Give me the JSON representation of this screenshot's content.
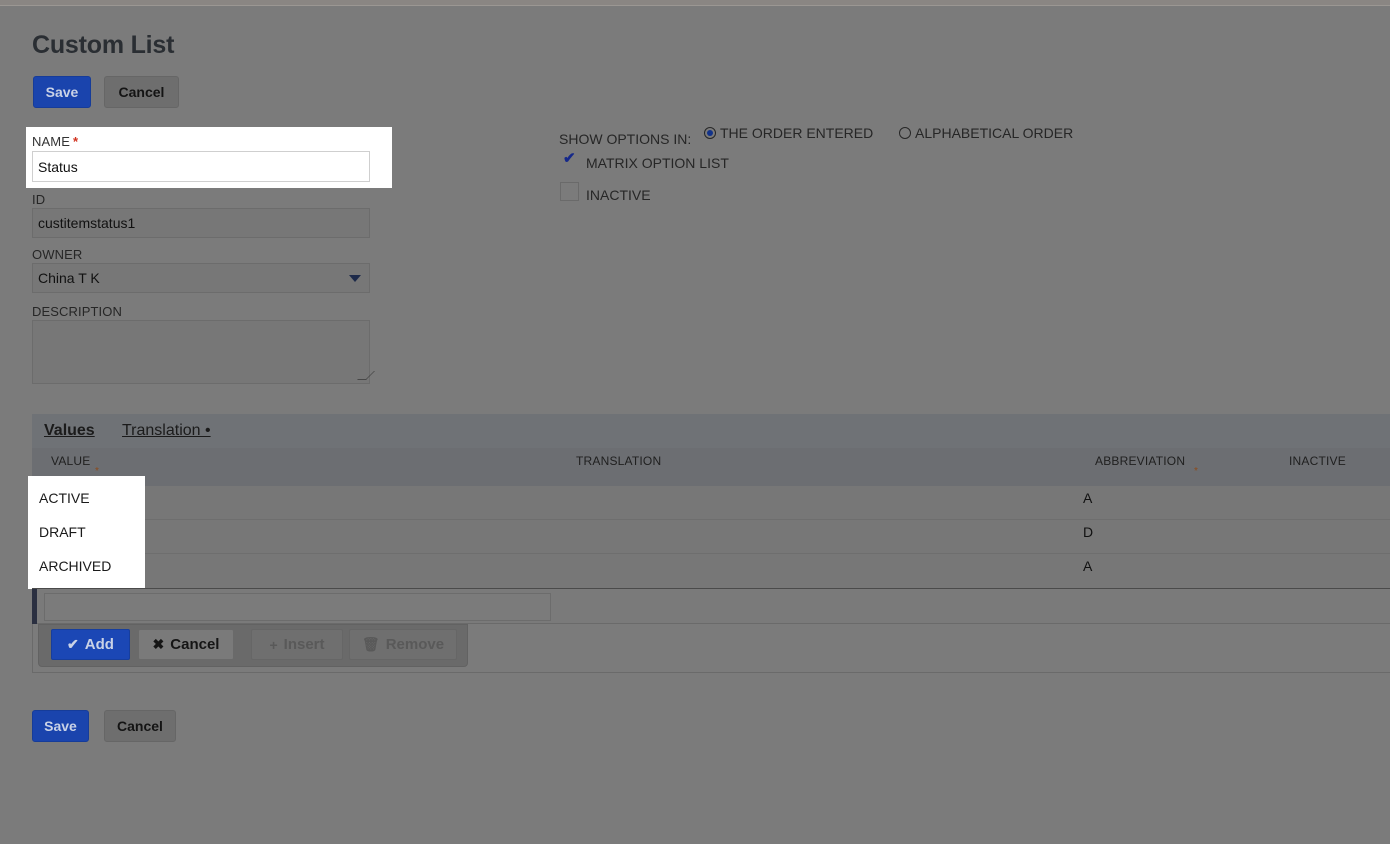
{
  "page": {
    "title": "Custom List"
  },
  "top_actions": {
    "save_label": "Save",
    "cancel_label": "Cancel"
  },
  "form": {
    "name": {
      "label": "NAME",
      "required_mark": "*",
      "value": "Status"
    },
    "id": {
      "label": "ID",
      "value": "custitemstatus1"
    },
    "owner": {
      "label": "OWNER",
      "value": "China T K"
    },
    "description": {
      "label": "DESCRIPTION",
      "value": ""
    }
  },
  "options": {
    "show_options_label": "SHOW OPTIONS IN:",
    "order_entered_label": "THE ORDER ENTERED",
    "alphabetical_label": "ALPHABETICAL ORDER",
    "selected": "THE ORDER ENTERED",
    "matrix_label": "MATRIX OPTION LIST",
    "matrix_checked": true,
    "inactive_label": "INACTIVE",
    "inactive_checked": false
  },
  "sublist": {
    "tabs": [
      {
        "label": "Values",
        "active": true
      },
      {
        "label": "Translation •",
        "active": false
      }
    ],
    "columns": {
      "value": "VALUE",
      "translation": "TRANSLATION",
      "abbreviation": "ABBREVIATION",
      "inactive": "INACTIVE",
      "required_mark": "*"
    },
    "rows": [
      {
        "value": "ACTIVE",
        "abbreviation": "A"
      },
      {
        "value": "DRAFT",
        "abbreviation": "D"
      },
      {
        "value": "ARCHIVED",
        "abbreviation": "A"
      }
    ],
    "toolbar": {
      "add_label": "Add",
      "cancel_label": "Cancel",
      "insert_label": "Insert",
      "remove_label": "Remove"
    }
  },
  "bottom_actions": {
    "save_label": "Save",
    "cancel_label": "Cancel"
  },
  "colors": {
    "primary_button": "#1a44ad",
    "overlay": "#7b7b7b",
    "highlight": "#ffffff"
  }
}
